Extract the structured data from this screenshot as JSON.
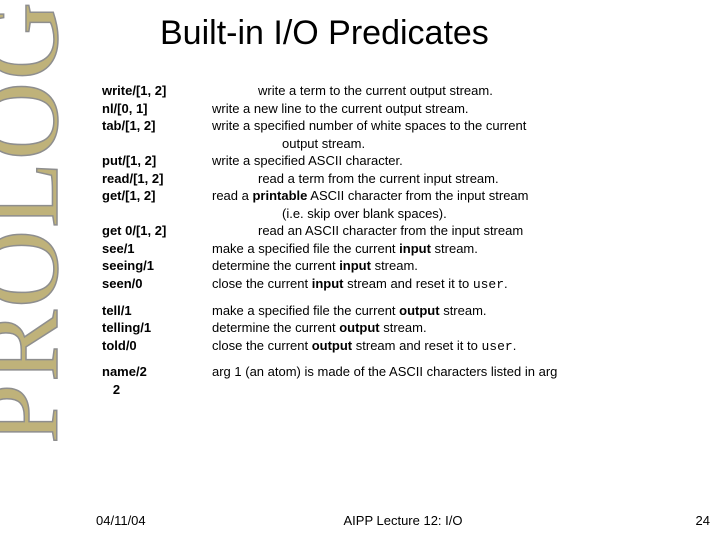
{
  "sideword": "PROLOG",
  "title": "Built-in I/O Predicates",
  "rows": [
    {
      "pred": "write/[1, 2]",
      "desc": "<span class='tab'></span>write a term to the current output stream."
    },
    {
      "pred": "nl/[0, 1]",
      "desc": "write a new line to the current output stream."
    },
    {
      "pred": "tab/[1, 2]",
      "desc": "write a specified number of white spaces to the current<span class='ind1'>output stream.</span>"
    },
    {
      "pred": "put/[1, 2]",
      "desc": "write a specified ASCII character."
    },
    {
      "pred": "read/[1, 2]",
      "desc": "<span class='tab'></span>read a term from the current input stream."
    },
    {
      "pred": "get/[1, 2]",
      "desc": "read a <b>printable</b> ASCII character from the input stream<span class='ind1'>(i.e. skip over blank spaces).</span>"
    },
    {
      "pred": "get 0/[1, 2]",
      "desc": "<span class='tab'></span>read an ASCII character from the input stream"
    },
    {
      "pred": "see/1",
      "desc": "make a specified file the current <b>input</b> stream."
    },
    {
      "pred": "seeing/1",
      "desc": "determine the current <b>input</b> stream."
    },
    {
      "pred": "seen/0",
      "desc": "close the current <b>input</b> stream and reset it to <code>user</code>."
    },
    {
      "gap": true
    },
    {
      "pred": "tell/1",
      "desc": "make a specified file the current <b>output</b> stream."
    },
    {
      "pred": "telling/1",
      "desc": "determine the current <b>output</b> stream."
    },
    {
      "pred": "told/0",
      "desc": "close the current <b>output</b> stream and reset it to <code>user</code>."
    },
    {
      "gap": true
    },
    {
      "pred": "name/2",
      "desc": "arg 1 (an atom) is made of the ASCII characters listed in arg"
    },
    {
      "pred": "   2",
      "desc": ""
    }
  ],
  "footer": {
    "left": "04/11/04",
    "mid": "AIPP Lecture 12: I/O",
    "right": "24"
  }
}
